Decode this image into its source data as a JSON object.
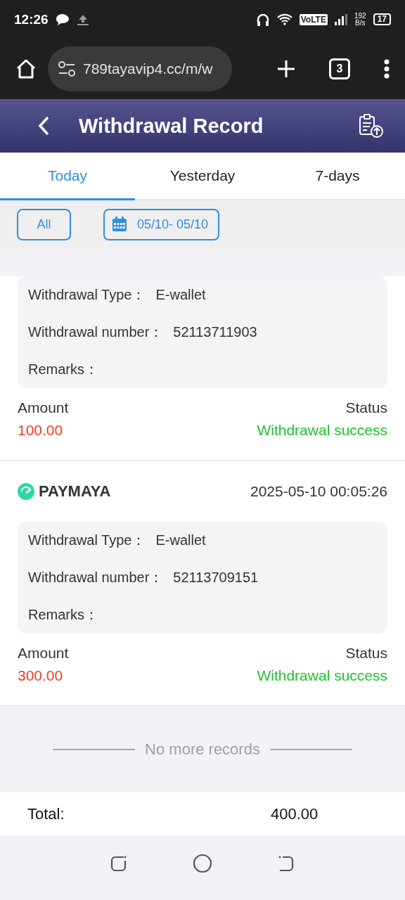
{
  "status_bar": {
    "time": "12:26",
    "volte": "VoLTE",
    "speed_value": "192",
    "speed_unit": "B/s",
    "battery": "17"
  },
  "browser": {
    "url": "789tayavip4.cc/m/w",
    "tab_count": "3"
  },
  "header": {
    "title": "Withdrawal Record"
  },
  "tabs": [
    {
      "label": "Today",
      "selected": true
    },
    {
      "label": "Yesterday",
      "selected": false
    },
    {
      "label": "7-days",
      "selected": false
    }
  ],
  "filters": [
    {
      "kind": "plain",
      "label": "All"
    },
    {
      "kind": "date",
      "label": "05/10- 05/10"
    }
  ],
  "records": [
    {
      "details": [
        {
          "label": "Withdrawal Type：",
          "value": "E-wallet"
        },
        {
          "label": "Withdrawal number：",
          "value": "52113711903"
        },
        {
          "label": "Remarks："
        }
      ],
      "amount_label": "Amount",
      "amount": "100.00",
      "status_label": "Status",
      "status": "Withdrawal success"
    },
    {
      "method": "PAYMAYA",
      "time": "2025-05-10 00:05:26",
      "details": [
        {
          "label": "Withdrawal Type：",
          "value": "E-wallet"
        },
        {
          "label": "Withdrawal number：",
          "value": "52113709151"
        },
        {
          "label": "Remarks："
        }
      ],
      "amount_label": "Amount",
      "amount": "300.00",
      "status_label": "Status",
      "status": "Withdrawal success"
    }
  ],
  "end_note": "No more records",
  "total": {
    "label": "Total:",
    "value": "400.00"
  }
}
